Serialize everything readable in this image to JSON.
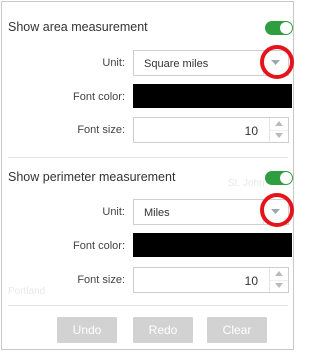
{
  "area": {
    "title": "Show area measurement",
    "toggle_on": true,
    "unit_label": "Unit:",
    "unit_value": "Square miles",
    "font_color_label": "Font color:",
    "font_color": "#000000",
    "font_size_label": "Font size:",
    "font_size": "10"
  },
  "perimeter": {
    "title": "Show perimeter measurement",
    "toggle_on": true,
    "unit_label": "Unit:",
    "unit_value": "Miles",
    "font_color_label": "Font color:",
    "font_color": "#000000",
    "font_size_label": "Font size:",
    "font_size": "10"
  },
  "actions": {
    "undo": "Undo",
    "redo": "Redo",
    "clear": "Clear"
  },
  "colors": {
    "toggle_green": "#2e9e3e",
    "highlight_red": "#e5141a",
    "disabled_button": "#d2d2d2"
  }
}
